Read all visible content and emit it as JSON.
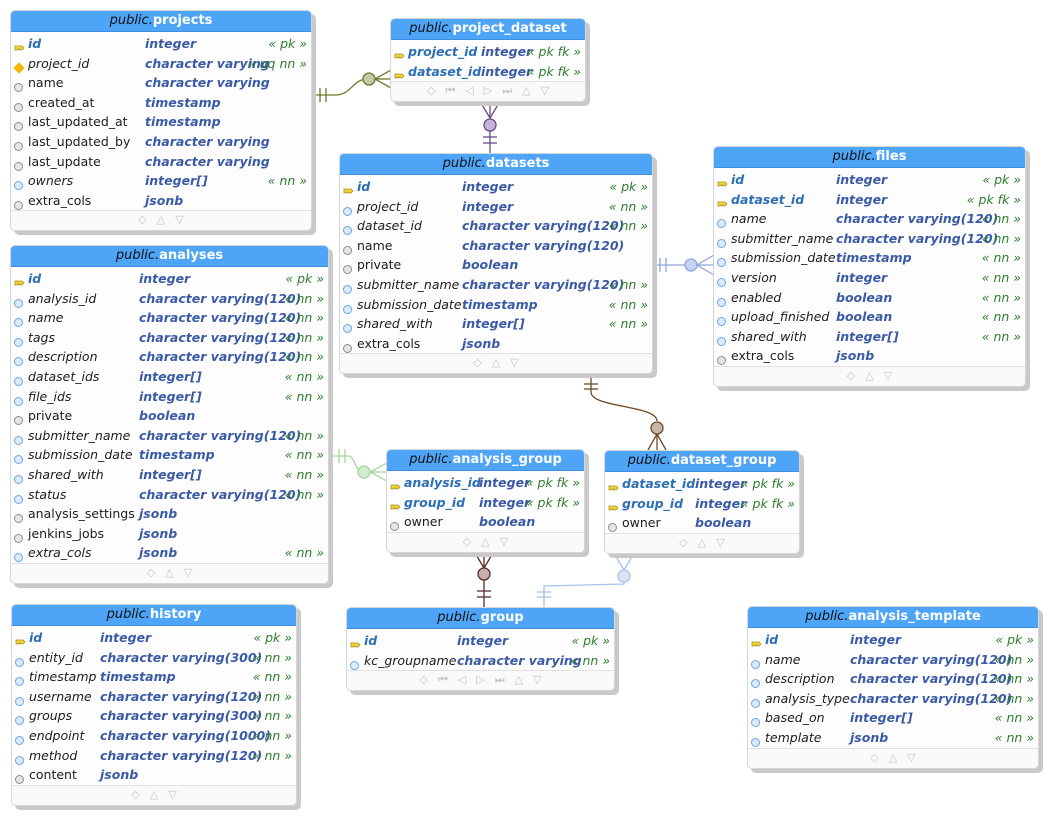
{
  "entities": {
    "projects": {
      "schema": "public.",
      "name": "projects",
      "columns": [
        {
          "name": "id",
          "type": "integer",
          "constraint": "« pk »",
          "icon": "key-icon"
        },
        {
          "name": "project_id",
          "type": "character varying",
          "constraint": "« uq nn »",
          "icon": "unique-diamond-icon"
        },
        {
          "name": "name",
          "type": "character varying",
          "constraint": "",
          "icon": "nullable-circle-icon"
        },
        {
          "name": "created_at",
          "type": "timestamp",
          "constraint": "",
          "icon": "nullable-circle-icon"
        },
        {
          "name": "last_updated_at",
          "type": "timestamp",
          "constraint": "",
          "icon": "nullable-circle-icon"
        },
        {
          "name": "last_updated_by",
          "type": "character varying",
          "constraint": "",
          "icon": "nullable-circle-icon"
        },
        {
          "name": "last_update",
          "type": "character varying",
          "constraint": "",
          "icon": "nullable-circle-icon"
        },
        {
          "name": "owners",
          "type": "integer[]",
          "constraint": "« nn »",
          "icon": "notnull-circle-icon"
        },
        {
          "name": "extra_cols",
          "type": "jsonb",
          "constraint": "",
          "icon": "nullable-circle-icon"
        }
      ],
      "footer": [
        "◇",
        "△",
        "▽"
      ]
    },
    "project_dataset": {
      "schema": "public.",
      "name": "project_dataset",
      "columns": [
        {
          "name": "project_id",
          "type": "integer",
          "constraint": "« pk fk »",
          "icon": "key-icon"
        },
        {
          "name": "dataset_id",
          "type": "integer",
          "constraint": "« pk fk »",
          "icon": "key-icon"
        }
      ],
      "footer": [
        "◇",
        "⏮",
        "◁",
        "▷",
        "⏭",
        "△",
        "▽"
      ]
    },
    "datasets": {
      "schema": "public.",
      "name": "datasets",
      "columns": [
        {
          "name": "id",
          "type": "integer",
          "constraint": "« pk »",
          "icon": "key-icon"
        },
        {
          "name": "project_id",
          "type": "integer",
          "constraint": "« nn »",
          "icon": "notnull-circle-icon"
        },
        {
          "name": "dataset_id",
          "type": "character varying(120)",
          "constraint": "« nn »",
          "icon": "notnull-circle-icon"
        },
        {
          "name": "name",
          "type": "character varying(120)",
          "constraint": "",
          "icon": "nullable-circle-icon"
        },
        {
          "name": "private",
          "type": "boolean",
          "constraint": "",
          "icon": "nullable-circle-icon"
        },
        {
          "name": "submitter_name",
          "type": "character varying(120)",
          "constraint": "« nn »",
          "icon": "notnull-circle-icon"
        },
        {
          "name": "submission_date",
          "type": "timestamp",
          "constraint": "« nn »",
          "icon": "notnull-circle-icon"
        },
        {
          "name": "shared_with",
          "type": "integer[]",
          "constraint": "« nn »",
          "icon": "notnull-circle-icon"
        },
        {
          "name": "extra_cols",
          "type": "jsonb",
          "constraint": "",
          "icon": "nullable-circle-icon"
        }
      ],
      "footer": [
        "◇",
        "△",
        "▽"
      ]
    },
    "files": {
      "schema": "public.",
      "name": "files",
      "columns": [
        {
          "name": "id",
          "type": "integer",
          "constraint": "« pk »",
          "icon": "key-icon"
        },
        {
          "name": "dataset_id",
          "type": "integer",
          "constraint": "« pk fk »",
          "icon": "key-icon"
        },
        {
          "name": "name",
          "type": "character varying(120)",
          "constraint": "« nn »",
          "icon": "notnull-circle-icon"
        },
        {
          "name": "submitter_name",
          "type": "character varying(120)",
          "constraint": "« nn »",
          "icon": "notnull-circle-icon"
        },
        {
          "name": "submission_date",
          "type": "timestamp",
          "constraint": "« nn »",
          "icon": "notnull-circle-icon"
        },
        {
          "name": "version",
          "type": "integer",
          "constraint": "« nn »",
          "icon": "notnull-circle-icon"
        },
        {
          "name": "enabled",
          "type": "boolean",
          "constraint": "« nn »",
          "icon": "notnull-circle-icon"
        },
        {
          "name": "upload_finished",
          "type": "boolean",
          "constraint": "« nn »",
          "icon": "notnull-circle-icon"
        },
        {
          "name": "shared_with",
          "type": "integer[]",
          "constraint": "« nn »",
          "icon": "notnull-circle-icon"
        },
        {
          "name": "extra_cols",
          "type": "jsonb",
          "constraint": "",
          "icon": "nullable-circle-icon"
        }
      ],
      "footer": [
        "◇",
        "△",
        "▽"
      ]
    },
    "analyses": {
      "schema": "public.",
      "name": "analyses",
      "columns": [
        {
          "name": "id",
          "type": "integer",
          "constraint": "« pk »",
          "icon": "key-icon"
        },
        {
          "name": "analysis_id",
          "type": "character varying(120)",
          "constraint": "« nn »",
          "icon": "notnull-circle-icon"
        },
        {
          "name": "name",
          "type": "character varying(120)",
          "constraint": "« nn »",
          "icon": "notnull-circle-icon"
        },
        {
          "name": "tags",
          "type": "character varying(120)",
          "constraint": "« nn »",
          "icon": "notnull-circle-icon"
        },
        {
          "name": "description",
          "type": "character varying(120)",
          "constraint": "« nn »",
          "icon": "notnull-circle-icon"
        },
        {
          "name": "dataset_ids",
          "type": "integer[]",
          "constraint": "« nn »",
          "icon": "notnull-circle-icon"
        },
        {
          "name": "file_ids",
          "type": "integer[]",
          "constraint": "« nn »",
          "icon": "notnull-circle-icon"
        },
        {
          "name": "private",
          "type": "boolean",
          "constraint": "",
          "icon": "nullable-circle-icon"
        },
        {
          "name": "submitter_name",
          "type": "character varying(120)",
          "constraint": "« nn »",
          "icon": "notnull-circle-icon"
        },
        {
          "name": "submission_date",
          "type": "timestamp",
          "constraint": "« nn »",
          "icon": "notnull-circle-icon"
        },
        {
          "name": "shared_with",
          "type": "integer[]",
          "constraint": "« nn »",
          "icon": "notnull-circle-icon"
        },
        {
          "name": "status",
          "type": "character varying(120)",
          "constraint": "« nn »",
          "icon": "notnull-circle-icon"
        },
        {
          "name": "analysis_settings",
          "type": "jsonb",
          "constraint": "",
          "icon": "nullable-circle-icon"
        },
        {
          "name": "jenkins_jobs",
          "type": "jsonb",
          "constraint": "",
          "icon": "nullable-circle-icon"
        },
        {
          "name": "extra_cols",
          "type": "jsonb",
          "constraint": "« nn »",
          "icon": "notnull-circle-icon"
        }
      ],
      "footer": [
        "◇",
        "△",
        "▽"
      ]
    },
    "analysis_group": {
      "schema": "public.",
      "name": "analysis_group",
      "columns": [
        {
          "name": "analysis_id",
          "type": "integer",
          "constraint": "« pk fk »",
          "icon": "key-icon"
        },
        {
          "name": "group_id",
          "type": "integer",
          "constraint": "« pk fk »",
          "icon": "key-icon"
        },
        {
          "name": "owner",
          "type": "boolean",
          "constraint": "",
          "icon": "nullable-circle-icon"
        }
      ],
      "footer": [
        "◇",
        "△",
        "▽"
      ]
    },
    "dataset_group": {
      "schema": "public.",
      "name": "dataset_group",
      "columns": [
        {
          "name": "dataset_id",
          "type": "integer",
          "constraint": "« pk fk »",
          "icon": "key-icon"
        },
        {
          "name": "group_id",
          "type": "integer",
          "constraint": "« pk fk »",
          "icon": "key-icon"
        },
        {
          "name": "owner",
          "type": "boolean",
          "constraint": "",
          "icon": "nullable-circle-icon"
        }
      ],
      "footer": [
        "◇",
        "△",
        "▽"
      ]
    },
    "group": {
      "schema": "public.",
      "name": "group",
      "columns": [
        {
          "name": "id",
          "type": "integer",
          "constraint": "« pk »",
          "icon": "key-icon"
        },
        {
          "name": "kc_groupname",
          "type": "character varying",
          "constraint": "« nn »",
          "icon": "notnull-circle-icon"
        }
      ],
      "footer": [
        "◇",
        "⏮",
        "◁",
        "▷",
        "⏭",
        "△",
        "▽"
      ]
    },
    "history": {
      "schema": "public.",
      "name": "history",
      "columns": [
        {
          "name": "id",
          "type": "integer",
          "constraint": "« pk »",
          "icon": "key-icon"
        },
        {
          "name": "entity_id",
          "type": "character varying(300)",
          "constraint": "« nn »",
          "icon": "notnull-circle-icon"
        },
        {
          "name": "timestamp",
          "type": "timestamp",
          "constraint": "« nn »",
          "icon": "notnull-circle-icon"
        },
        {
          "name": "username",
          "type": "character varying(120)",
          "constraint": "« nn »",
          "icon": "notnull-circle-icon"
        },
        {
          "name": "groups",
          "type": "character varying(300)",
          "constraint": "« nn »",
          "icon": "notnull-circle-icon"
        },
        {
          "name": "endpoint",
          "type": "character varying(1000)",
          "constraint": "« nn »",
          "icon": "notnull-circle-icon"
        },
        {
          "name": "method",
          "type": "character varying(120)",
          "constraint": "« nn »",
          "icon": "notnull-circle-icon"
        },
        {
          "name": "content",
          "type": "jsonb",
          "constraint": "",
          "icon": "nullable-circle-icon"
        }
      ],
      "footer": [
        "◇",
        "△",
        "▽"
      ]
    },
    "analysis_template": {
      "schema": "public.",
      "name": "analysis_template",
      "columns": [
        {
          "name": "id",
          "type": "integer",
          "constraint": "« pk »",
          "icon": "key-icon"
        },
        {
          "name": "name",
          "type": "character varying(120)",
          "constraint": "« nn »",
          "icon": "notnull-circle-icon"
        },
        {
          "name": "description",
          "type": "character varying(120)",
          "constraint": "« nn »",
          "icon": "notnull-circle-icon"
        },
        {
          "name": "analysis_type",
          "type": "character varying(120)",
          "constraint": "« nn »",
          "icon": "notnull-circle-icon"
        },
        {
          "name": "based_on",
          "type": "integer[]",
          "constraint": "« nn »",
          "icon": "notnull-circle-icon"
        },
        {
          "name": "template",
          "type": "jsonb",
          "constraint": "« nn »",
          "icon": "notnull-circle-icon"
        }
      ],
      "footer": [
        "◇",
        "△",
        "▽"
      ]
    }
  },
  "relationships": [
    {
      "from": "projects",
      "to": "project_dataset",
      "color": "#6b7a2a"
    },
    {
      "from": "datasets",
      "to": "project_dataset",
      "color": "#6a4a8a"
    },
    {
      "from": "datasets",
      "to": "files",
      "color": "#8da4de"
    },
    {
      "from": "datasets",
      "to": "dataset_group",
      "color": "#6b4a2a"
    },
    {
      "from": "analyses",
      "to": "analysis_group",
      "color": "#a5d6a0"
    },
    {
      "from": "group",
      "to": "analysis_group",
      "color": "#5a2a2a"
    },
    {
      "from": "group",
      "to": "dataset_group",
      "color": "#a8c4e8"
    }
  ]
}
